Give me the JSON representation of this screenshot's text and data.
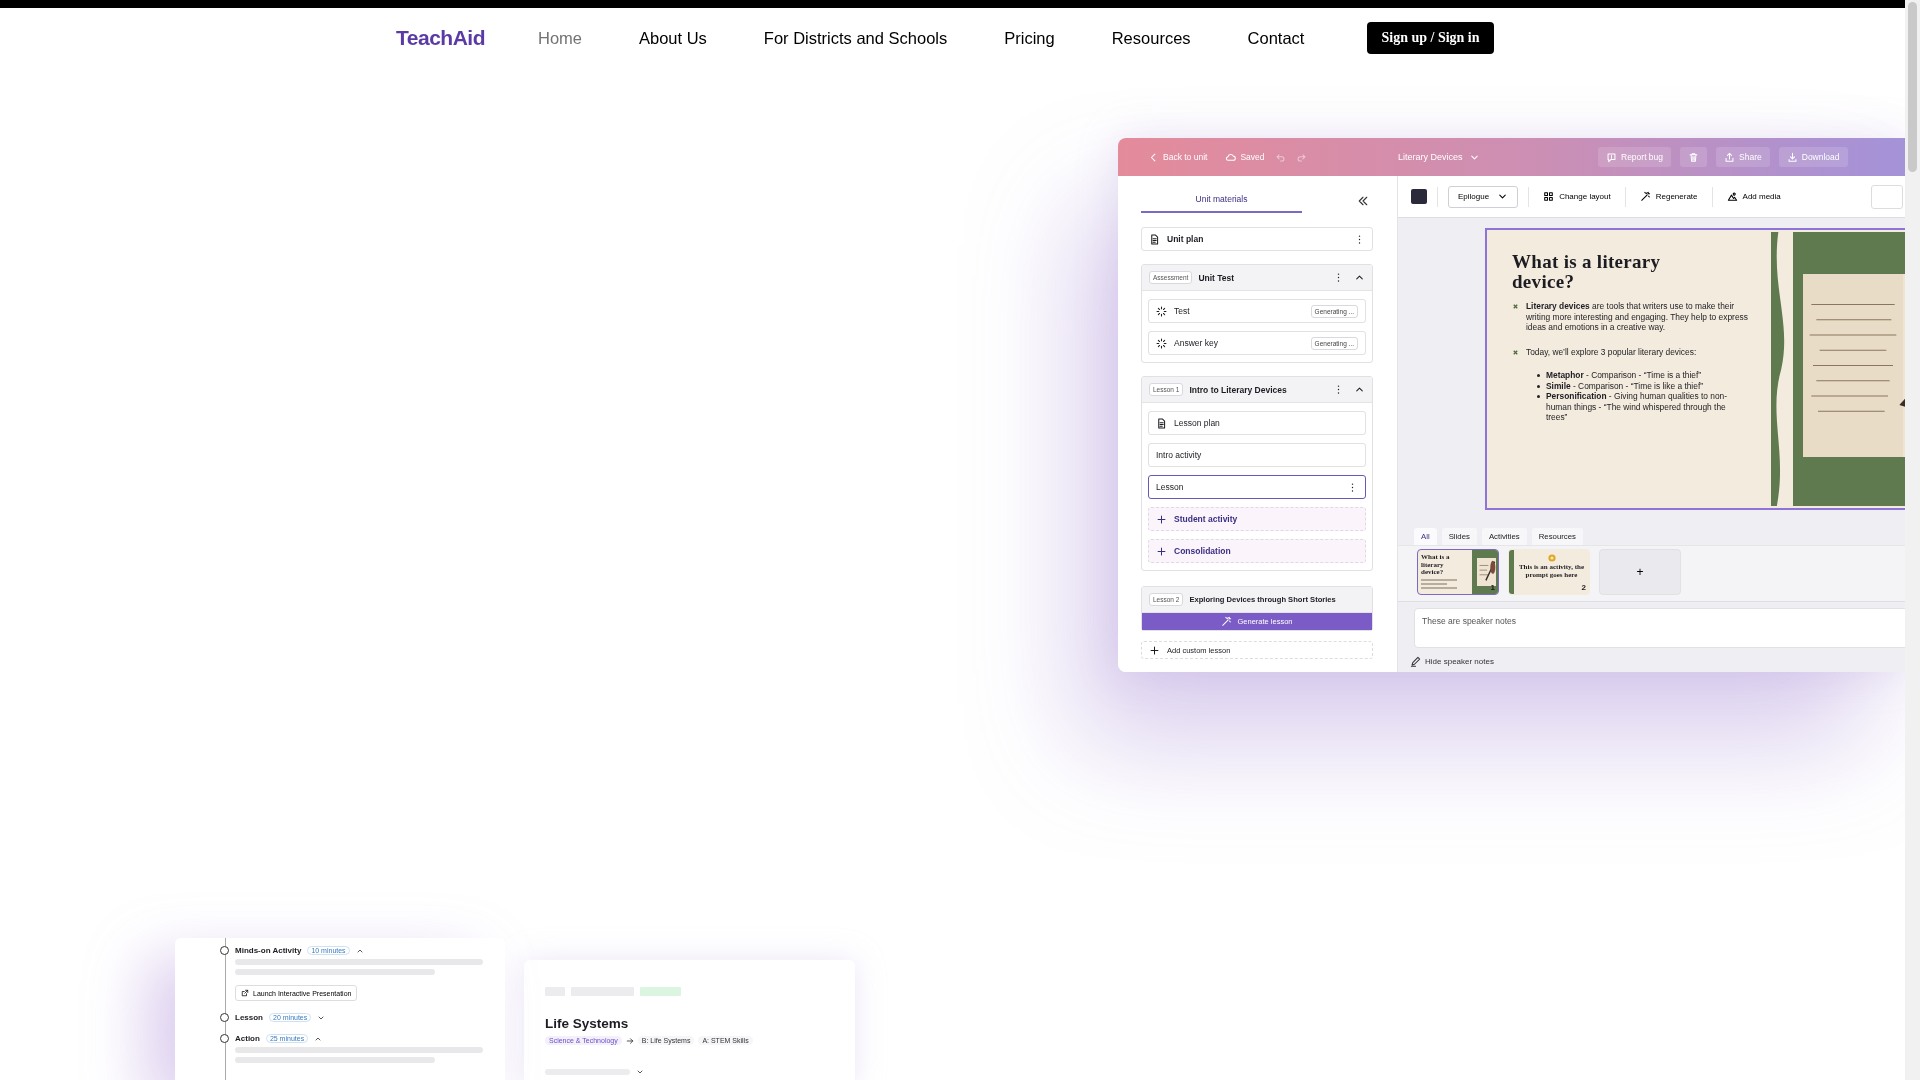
{
  "nav": {
    "logo": "TeachAid",
    "links": [
      {
        "label": "Home",
        "selected": true
      },
      {
        "label": "About Us",
        "selected": false
      },
      {
        "label": "For Districts and Schools",
        "selected": false
      },
      {
        "label": "Pricing",
        "selected": false
      },
      {
        "label": "Resources",
        "selected": false
      },
      {
        "label": "Contact",
        "selected": false
      }
    ],
    "cta": "Sign up / Sign in"
  },
  "app": {
    "header": {
      "back": "Back to unit",
      "saved": "Saved",
      "title": "Literary Devices",
      "actions": [
        {
          "kind": "report",
          "label": "Report bug"
        },
        {
          "kind": "trash"
        },
        {
          "kind": "share",
          "label": "Share"
        },
        {
          "kind": "download",
          "label": "Download"
        }
      ]
    },
    "sidebar": {
      "tab": "Unit materials",
      "items": [
        {
          "kind": "file",
          "label": "Unit plan"
        },
        {
          "kind": "group",
          "tag": "Assessment",
          "title": "Unit Test",
          "expanded": true,
          "children": [
            {
              "kind": "generating",
              "label": "Test",
              "status": "Generating ..."
            },
            {
              "kind": "generating",
              "label": "Answer key",
              "status": "Generating ..."
            }
          ]
        },
        {
          "kind": "group",
          "tag": "Lesson 1",
          "title": "Intro to Literary Devices",
          "expanded": true,
          "children": [
            {
              "kind": "doc",
              "label": "Lesson plan"
            },
            {
              "kind": "plain",
              "label": "Intro activity",
              "selected": false
            },
            {
              "kind": "plain",
              "label": "Lesson",
              "selected": true
            },
            {
              "kind": "add",
              "label": "Student activity"
            },
            {
              "kind": "add",
              "label": "Consolidation"
            }
          ]
        },
        {
          "kind": "pending",
          "tag": "Lesson 2",
          "title": "Exploring Devices through Short Stories",
          "action": "Generate lesson"
        },
        {
          "kind": "custom",
          "label": "Add custom lesson"
        }
      ]
    },
    "toolbar": {
      "font": "Epilogue",
      "actions": [
        {
          "kind": "layout",
          "label": "Change layout"
        },
        {
          "kind": "regenerate",
          "label": "Regenerate"
        },
        {
          "kind": "media",
          "label": "Add media"
        }
      ]
    },
    "slide": {
      "title": "What is a literary device?",
      "bullets": [
        "**Literary devices** are tools that writers use to make their writing more interesting and engaging. They help to express ideas and emotions in a creative way.",
        "Today, we’ll explore 3 popular literary devices:"
      ],
      "sub_bullets": [
        "**Metaphor** - Comparison - “Time is a thief”",
        "**Simile** - Comparison - “Time is like a thief”",
        "**Personification** - Giving human qualities to non-human things - “The wind whispered through the trees”"
      ]
    },
    "filter_tabs": [
      {
        "label": "All",
        "selected": true
      },
      {
        "label": "Slides",
        "selected": false
      },
      {
        "label": "Activities",
        "selected": false
      },
      {
        "label": "Resources",
        "selected": false
      }
    ],
    "thumbnails": [
      {
        "kind": "content",
        "number": "1",
        "title": "What is a literary device?",
        "selected": true
      },
      {
        "kind": "activity",
        "number": "2",
        "title": "This is an activity, the prompt goes here",
        "selected": false
      }
    ],
    "add_slide": "+",
    "notes": {
      "value": "These are speaker notes"
    },
    "hide_notes": "Hide speaker notes"
  },
  "lesson_card": {
    "steps": [
      {
        "title": "Minds-on Activity",
        "duration": "10 minutes",
        "expanded": true,
        "button": "Launch Interactive Presentation"
      },
      {
        "title": "Lesson",
        "duration": "20 minutes",
        "expanded": false
      },
      {
        "title": "Action",
        "duration": "25 minutes",
        "expanded": true
      }
    ]
  },
  "unit_card": {
    "title": "Life Systems",
    "tags": [
      "Science & Technology",
      "B: Life Systems",
      "A: STEM Skills"
    ]
  }
}
